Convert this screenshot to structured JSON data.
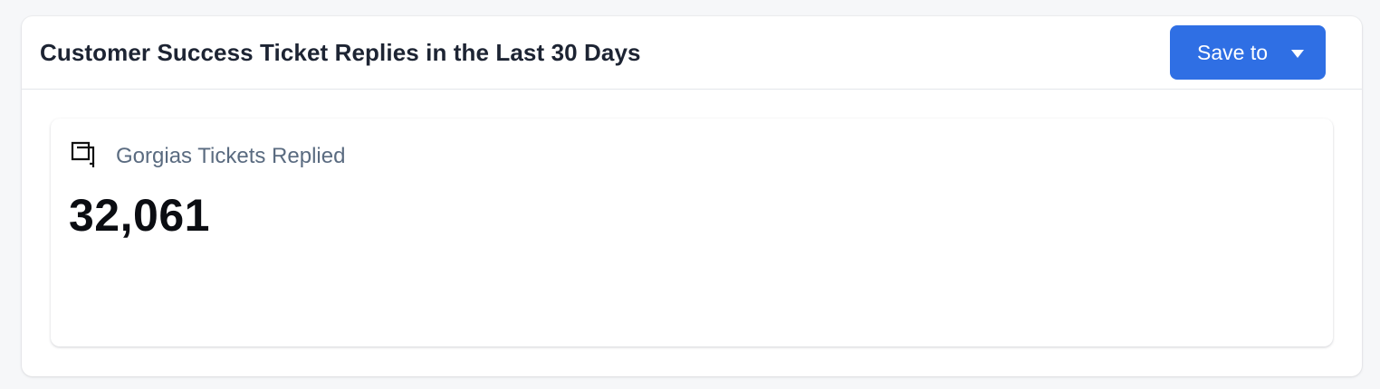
{
  "header": {
    "title": "Customer Success Ticket Replies in the Last 30 Days",
    "save_label": "Save to"
  },
  "metric": {
    "label": "Gorgias Tickets Replied",
    "value": "32,061",
    "icon": "ticket-stack-icon"
  },
  "colors": {
    "accent": "#2f6fe4",
    "title": "#1d2433",
    "label": "#5a6b80"
  }
}
